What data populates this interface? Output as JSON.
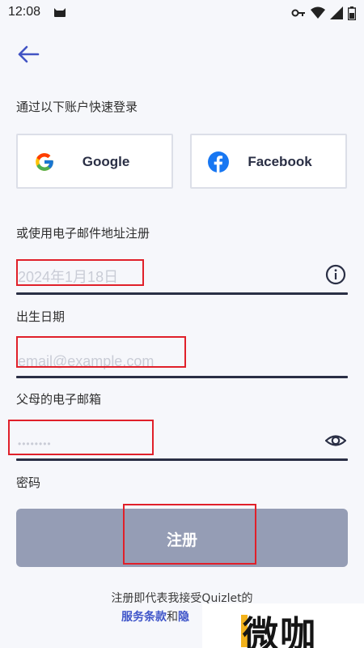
{
  "status_bar": {
    "time": "12:08",
    "icons": [
      "cat-icon",
      "key-icon",
      "wifi-icon",
      "signal-icon",
      "battery-icon"
    ]
  },
  "nav": {
    "back_icon": "arrow-left-icon"
  },
  "quick_login": {
    "title": "通过以下账户快速登录",
    "google_label": "Google",
    "facebook_label": "Facebook"
  },
  "email_signup": {
    "title": "或使用电子邮件地址注册"
  },
  "fields": {
    "birthday": {
      "value": "2024年1月18日",
      "label": "出生日期"
    },
    "parent_email": {
      "placeholder": "email@example.com",
      "label": "父母的电子邮箱"
    },
    "password": {
      "value": "••••••••",
      "label": "密码"
    }
  },
  "register": {
    "label": "注册"
  },
  "terms": {
    "line1": "注册即代表我接受Quizlet的",
    "link1": "服务条款",
    "and": "和",
    "link2": "隐"
  },
  "watermark": {
    "text": "微咖"
  },
  "colors": {
    "background": "#f6f7fb",
    "accent": "#3f55c9",
    "underline": "#2a2f45",
    "button_disabled": "#959db5",
    "highlight": "#e0202a"
  }
}
